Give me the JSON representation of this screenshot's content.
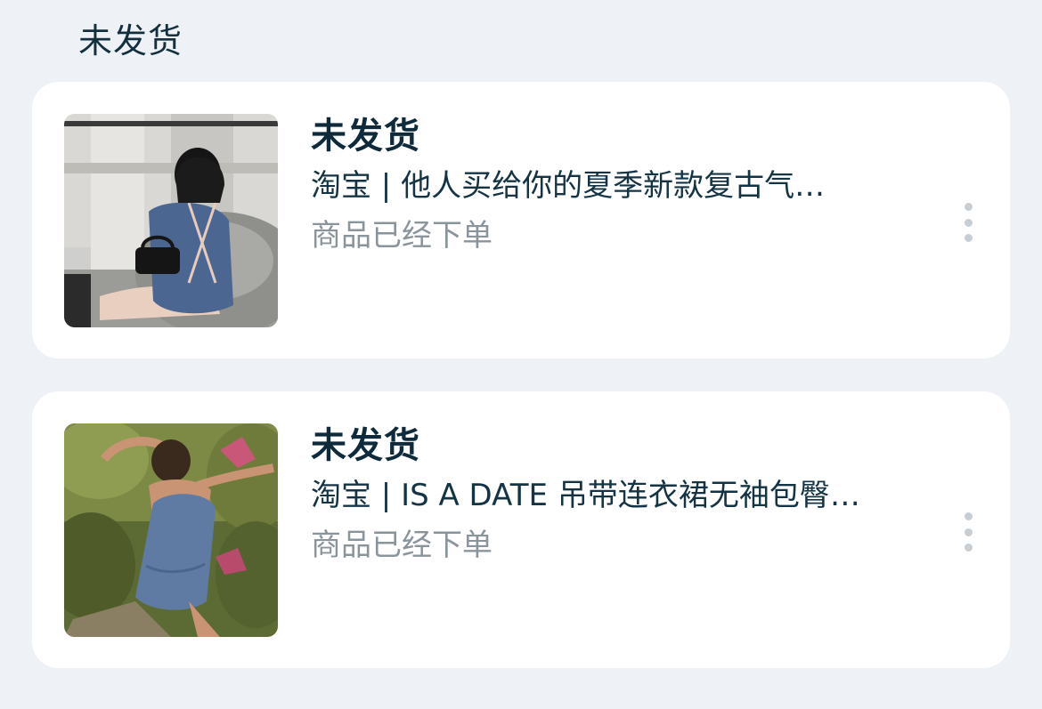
{
  "section": {
    "title": "未发货"
  },
  "orders": [
    {
      "title": "未发货",
      "subtitle": "淘宝 | 他人买给你的夏季新款复古气…",
      "status": "商品已经下单",
      "thumbnail_icon": "product-photo-denim-dress-seated"
    },
    {
      "title": "未发货",
      "subtitle": "淘宝 | IS A DATE 吊带连衣裙无袖包臀…",
      "status": "商品已经下单",
      "thumbnail_icon": "product-photo-denim-dress-outdoor"
    }
  ],
  "colors": {
    "background": "#eef2f7",
    "card": "#ffffff",
    "title": "#0f2b3b",
    "subtitle": "#143445",
    "status": "#8a949b",
    "more_dots": "#c7ced4"
  }
}
